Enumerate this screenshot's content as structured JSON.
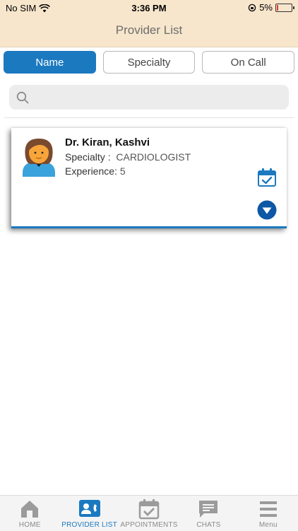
{
  "status_bar": {
    "carrier": "No SIM",
    "time": "3:36 PM",
    "battery": "5%",
    "battery_level": 0.05
  },
  "header": {
    "title": "Provider List",
    "background": "#f7e6cc"
  },
  "segments": [
    {
      "label": "Name",
      "active": true
    },
    {
      "label": "Specialty",
      "active": false
    },
    {
      "label": "On Call",
      "active": false
    }
  ],
  "search": {
    "placeholder": "",
    "value": ""
  },
  "providers": [
    {
      "name": "Dr. Kiran, Kashvi",
      "specialty_label": "Specialty :",
      "specialty_value": "CARDIOLOGIST",
      "experience_label": "Experience:",
      "experience_value": "5"
    }
  ],
  "tabs": [
    {
      "label": "HOME",
      "icon": "home-icon",
      "active": false
    },
    {
      "label": "PROVIDER LIST",
      "icon": "provider-list-icon",
      "active": true
    },
    {
      "label": "APPOINTMENTS",
      "icon": "appointments-icon",
      "active": false
    },
    {
      "label": "CHATS",
      "icon": "chat-icon",
      "active": false
    },
    {
      "label": "Menu",
      "icon": "menu-icon",
      "active": false
    }
  ],
  "colors": {
    "accent": "#1b79c0",
    "inactive": "#8a8a8a"
  }
}
